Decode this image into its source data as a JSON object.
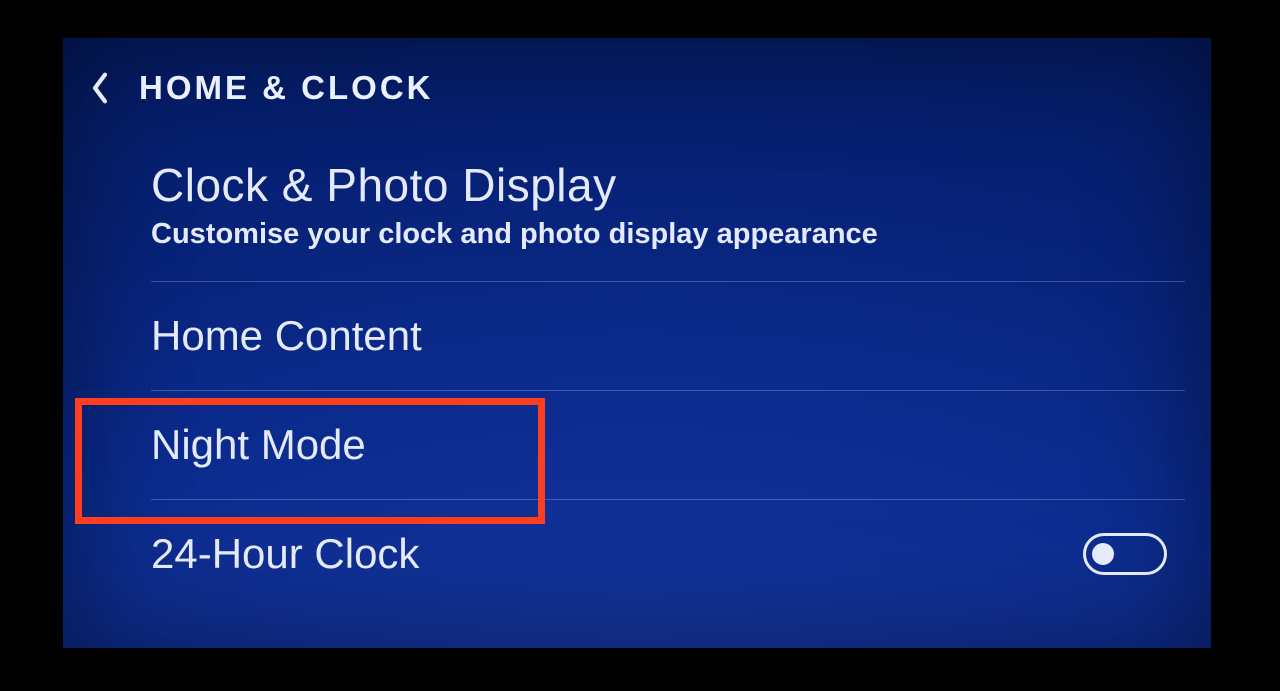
{
  "header": {
    "title": "HOME & CLOCK"
  },
  "section": {
    "title": "Clock & Photo Display",
    "subtitle": "Customise your clock and photo display appearance"
  },
  "rows": {
    "home_content": {
      "label": "Home Content"
    },
    "night_mode": {
      "label": "Night Mode"
    },
    "clock_24h": {
      "label": "24-Hour Clock",
      "toggle": false
    }
  },
  "highlight": {
    "target": "night_mode",
    "color": "#ff3d1f"
  }
}
